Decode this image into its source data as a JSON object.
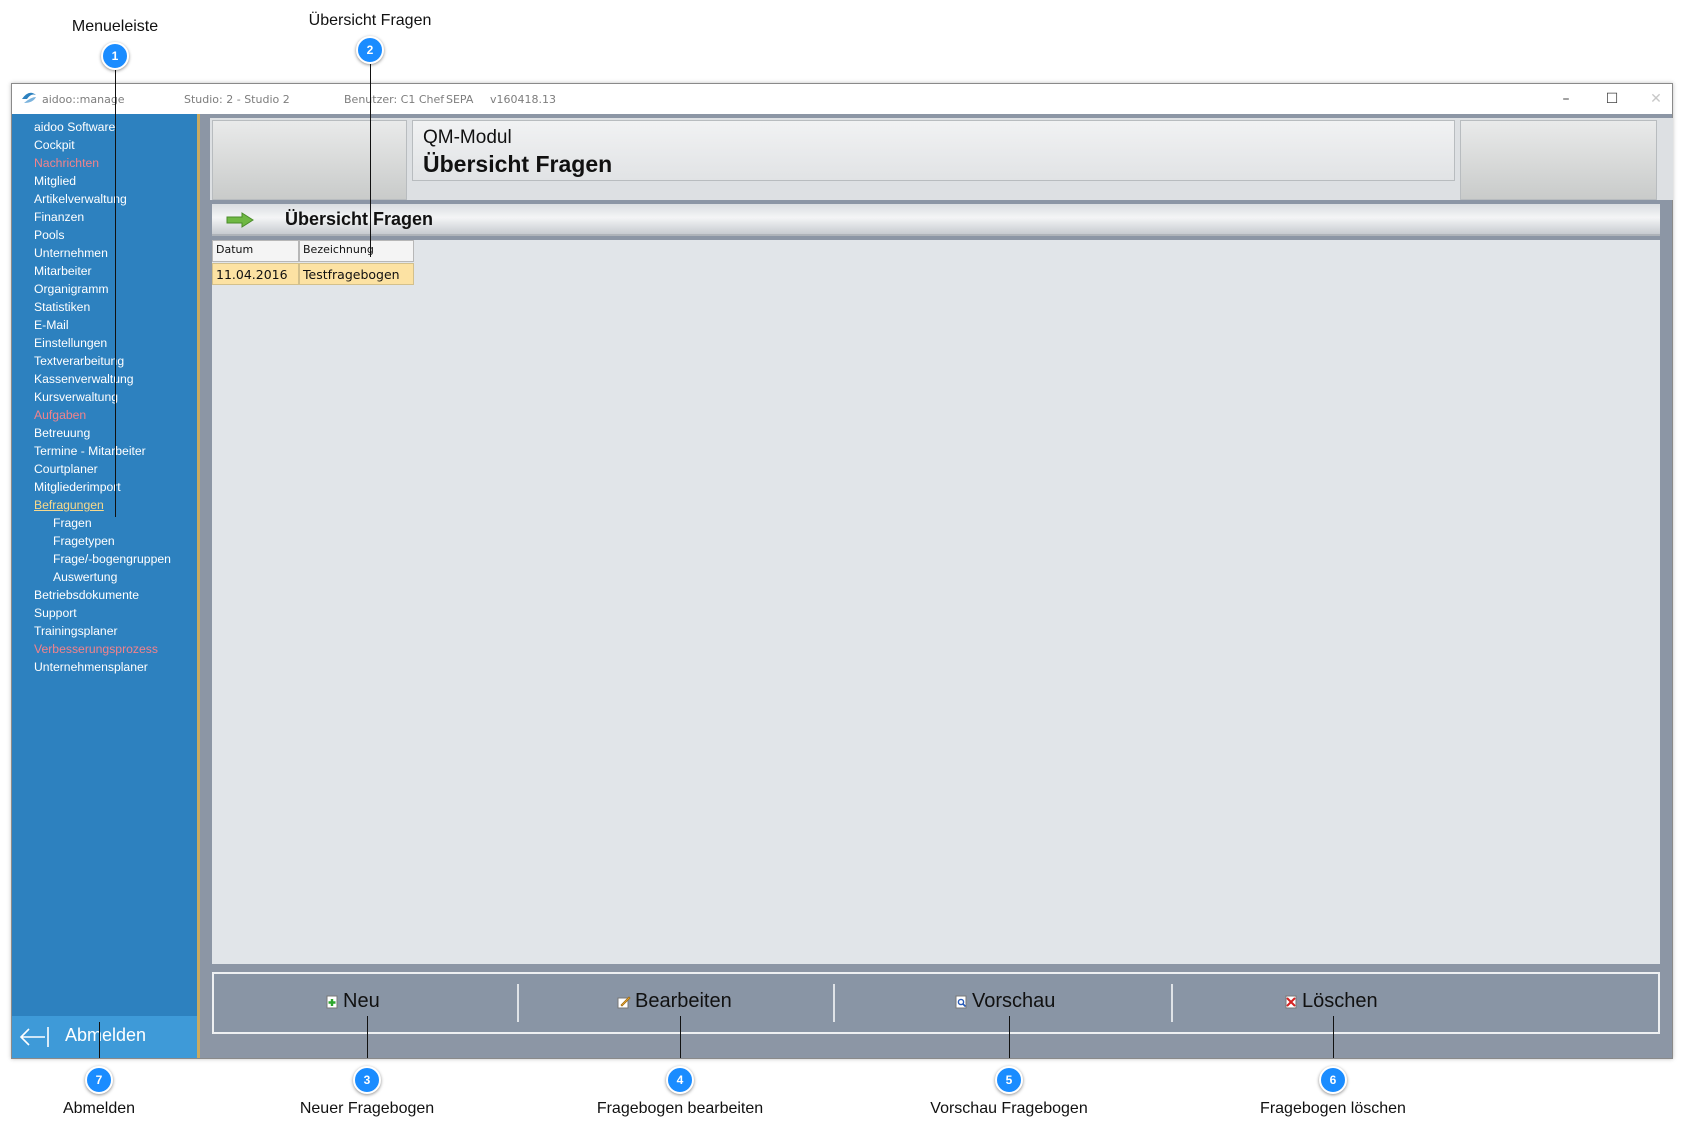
{
  "callouts": [
    {
      "number": "1",
      "label": "Menueleiste"
    },
    {
      "number": "2",
      "label": "Übersicht Fragen"
    },
    {
      "number": "3",
      "label": "Neuer Fragebogen"
    },
    {
      "number": "4",
      "label": "Fragebogen bearbeiten"
    },
    {
      "number": "5",
      "label": "Vorschau Fragebogen"
    },
    {
      "number": "6",
      "label": "Fragebogen löschen"
    },
    {
      "number": "7",
      "label": "Abmelden"
    }
  ],
  "window": {
    "app_name": "aidoo::manage",
    "studio": "Studio: 2 - Studio 2",
    "user": "Benutzer: C1 Chef",
    "payment": "SEPA",
    "version": "v160418.13",
    "controls": {
      "minimize": "–",
      "maximize": "☐",
      "close": "✕"
    }
  },
  "sidebar": {
    "items": [
      {
        "label": "aidoo Software",
        "style": "normal"
      },
      {
        "label": "Cockpit",
        "style": "normal"
      },
      {
        "label": "Nachrichten",
        "style": "red"
      },
      {
        "label": "Mitglied",
        "style": "normal"
      },
      {
        "label": "Artikelverwaltung",
        "style": "normal"
      },
      {
        "label": "Finanzen",
        "style": "normal"
      },
      {
        "label": "Pools",
        "style": "normal"
      },
      {
        "label": "Unternehmen",
        "style": "normal"
      },
      {
        "label": "Mitarbeiter",
        "style": "normal"
      },
      {
        "label": "Organigramm",
        "style": "normal"
      },
      {
        "label": "Statistiken",
        "style": "normal"
      },
      {
        "label": "E-Mail",
        "style": "normal"
      },
      {
        "label": "Einstellungen",
        "style": "normal"
      },
      {
        "label": "Textverarbeitung",
        "style": "normal"
      },
      {
        "label": "Kassenverwaltung",
        "style": "normal"
      },
      {
        "label": "Kursverwaltung",
        "style": "normal"
      },
      {
        "label": "Aufgaben",
        "style": "red"
      },
      {
        "label": "Betreuung",
        "style": "normal"
      },
      {
        "label": "Termine - Mitarbeiter",
        "style": "normal"
      },
      {
        "label": "Courtplaner",
        "style": "normal"
      },
      {
        "label": "Mitgliederimport",
        "style": "normal"
      },
      {
        "label": "Befragungen",
        "style": "active"
      },
      {
        "label": "Fragen",
        "style": "sub"
      },
      {
        "label": "Fragetypen",
        "style": "sub"
      },
      {
        "label": "Frage/-bogengruppen",
        "style": "sub"
      },
      {
        "label": "Auswertung",
        "style": "sub"
      },
      {
        "label": "Betriebsdokumente",
        "style": "normal"
      },
      {
        "label": "Support",
        "style": "normal"
      },
      {
        "label": "Trainingsplaner",
        "style": "normal"
      },
      {
        "label": "Verbesserungsprozess",
        "style": "red"
      },
      {
        "label": "Unternehmensplaner",
        "style": "normal"
      }
    ],
    "logout_label": "Abmelden",
    "logout_icon": "logout-arrow-icon"
  },
  "header": {
    "module": "QM-Modul",
    "page_title": "Übersicht Fragen"
  },
  "section": {
    "title": "Übersicht Fragen",
    "icon": "green-arrow-icon"
  },
  "table": {
    "columns": [
      "Datum",
      "Bezeichnung"
    ],
    "rows": [
      [
        "11.04.2016",
        "Testfragebogen"
      ]
    ]
  },
  "toolbar": {
    "new_label": "Neu",
    "edit_label": "Bearbeiten",
    "preview_label": "Vorschau",
    "delete_label": "Löschen"
  },
  "colors": {
    "sidebar": "#2d81bf",
    "badge": "#1a8cff",
    "selected_row": "#fce2a3",
    "red_menu_text": "#f2838c",
    "active_menu_text": "#f6d98d"
  }
}
